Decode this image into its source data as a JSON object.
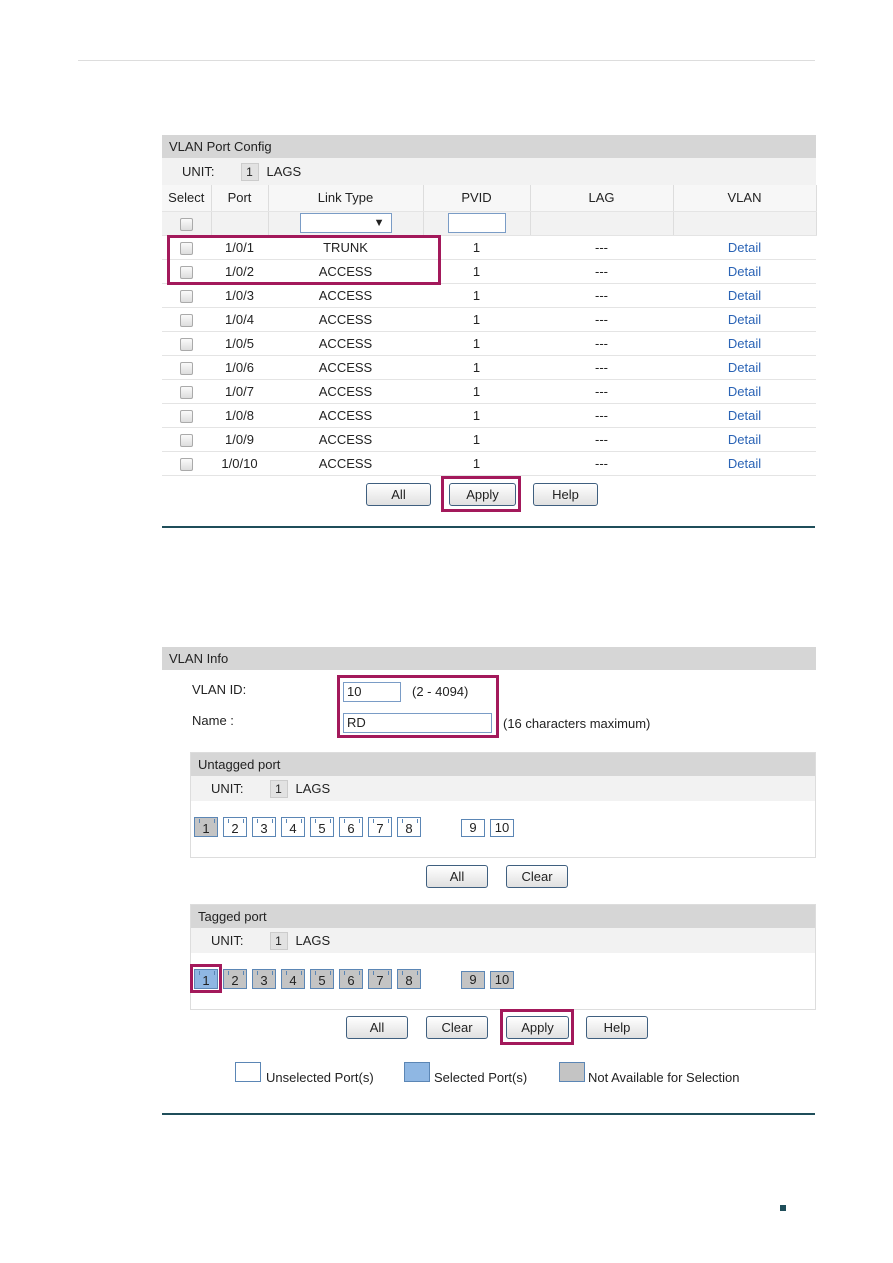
{
  "port_config": {
    "title": "VLAN Port Config",
    "unit_label": "UNIT:",
    "unit_value": "1",
    "lags_label": "LAGS",
    "columns": [
      "Select",
      "Port",
      "Link Type",
      "PVID",
      "LAG",
      "VLAN"
    ],
    "filter": {
      "link_type": "",
      "pvid": "",
      "dropdown_icon": "▼"
    },
    "rows": [
      {
        "port": "1/0/1",
        "link_type": "TRUNK",
        "pvid": "1",
        "lag": "---",
        "vlan": "Detail"
      },
      {
        "port": "1/0/2",
        "link_type": "ACCESS",
        "pvid": "1",
        "lag": "---",
        "vlan": "Detail"
      },
      {
        "port": "1/0/3",
        "link_type": "ACCESS",
        "pvid": "1",
        "lag": "---",
        "vlan": "Detail"
      },
      {
        "port": "1/0/4",
        "link_type": "ACCESS",
        "pvid": "1",
        "lag": "---",
        "vlan": "Detail"
      },
      {
        "port": "1/0/5",
        "link_type": "ACCESS",
        "pvid": "1",
        "lag": "---",
        "vlan": "Detail"
      },
      {
        "port": "1/0/6",
        "link_type": "ACCESS",
        "pvid": "1",
        "lag": "---",
        "vlan": "Detail"
      },
      {
        "port": "1/0/7",
        "link_type": "ACCESS",
        "pvid": "1",
        "lag": "---",
        "vlan": "Detail"
      },
      {
        "port": "1/0/8",
        "link_type": "ACCESS",
        "pvid": "1",
        "lag": "---",
        "vlan": "Detail"
      },
      {
        "port": "1/0/9",
        "link_type": "ACCESS",
        "pvid": "1",
        "lag": "---",
        "vlan": "Detail"
      },
      {
        "port": "1/0/10",
        "link_type": "ACCESS",
        "pvid": "1",
        "lag": "---",
        "vlan": "Detail"
      }
    ],
    "buttons": {
      "all": "All",
      "apply": "Apply",
      "help": "Help"
    }
  },
  "vlan_info": {
    "title": "VLAN Info",
    "vlan_id_label": "VLAN ID:",
    "vlan_id_value": "10",
    "vlan_id_hint": "(2 - 4094)",
    "name_label": "Name :",
    "name_value": "RD",
    "name_hint": "(16 characters maximum)",
    "untagged": {
      "title": "Untagged port",
      "unit_label": "UNIT:",
      "unit_value": "1",
      "lags_label": "LAGS",
      "ports": [
        "1",
        "2",
        "3",
        "4",
        "5",
        "6",
        "7",
        "8",
        "9",
        "10"
      ],
      "states": [
        "na",
        "off",
        "off",
        "off",
        "off",
        "off",
        "off",
        "off",
        "off",
        "off"
      ],
      "buttons": {
        "all": "All",
        "clear": "Clear"
      }
    },
    "tagged": {
      "title": "Tagged port",
      "unit_label": "UNIT:",
      "unit_value": "1",
      "lags_label": "LAGS",
      "ports": [
        "1",
        "2",
        "3",
        "4",
        "5",
        "6",
        "7",
        "8",
        "9",
        "10"
      ],
      "states": [
        "on",
        "na",
        "na",
        "na",
        "na",
        "na",
        "na",
        "na",
        "na",
        "na"
      ],
      "buttons": {
        "all": "All",
        "clear": "Clear",
        "apply": "Apply",
        "help": "Help"
      }
    },
    "legend": [
      "Unselected Port(s)",
      "Selected Port(s)",
      "Not Available for Selection"
    ]
  },
  "colors": {
    "highlight": "#a3195b",
    "link": "#2a63b5",
    "selected_port": "#8fb7e3",
    "unavailable_port": "#c4c4c4"
  }
}
